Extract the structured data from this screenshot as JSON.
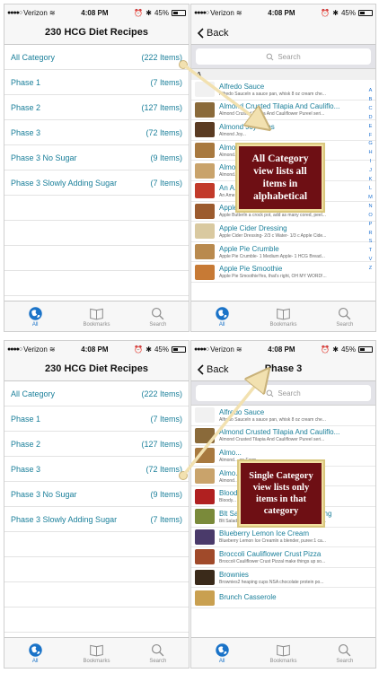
{
  "status": {
    "carrier": "Verizon",
    "time": "4:08 PM",
    "battery_text": "45%",
    "battery_level": 0.45
  },
  "home": {
    "title": "230 HCG Diet Recipes",
    "rows": [
      {
        "label": "All Category",
        "count": "(222 Items)"
      },
      {
        "label": "Phase 1",
        "count": "(7 Items)"
      },
      {
        "label": "Phase 2",
        "count": "(127 Items)"
      },
      {
        "label": "Phase 3",
        "count": "(72 Items)"
      },
      {
        "label": "Phase 3 No Sugar",
        "count": "(9 Items)"
      },
      {
        "label": "Phase 3 Slowly Adding Sugar",
        "count": "(7 Items)"
      }
    ]
  },
  "all_list": {
    "back_label": "Back",
    "search_placeholder": "Search",
    "section": "A",
    "index": [
      "A",
      "B",
      "C",
      "D",
      "E",
      "F",
      "G",
      "H",
      "I",
      "J",
      "K",
      "L",
      "M",
      "N",
      "O",
      "P",
      "R",
      "S",
      "T",
      "V",
      "Z"
    ],
    "rows": [
      {
        "title": "Alfredo Sauce",
        "desc": "Alfredo Sauceln a sauce pan, whisk 8 oz cream che...",
        "color": "#f1f1f1"
      },
      {
        "title": "Almond Crusted Tilapia And Cauliflo...",
        "desc": "Almond Crusted Tilapia And Cauliflower Pureel seri...",
        "color": "#8a6a3a"
      },
      {
        "title": "Almond Joy Bites",
        "desc": "Almond Joy...",
        "color": "#5a3b22"
      },
      {
        "title": "Almo...",
        "desc": "Almond...                on Farm...",
        "color": "#a8793f"
      },
      {
        "title": "Almo...",
        "desc": "Almond...                flour 1 t...",
        "color": "#c9a36b"
      },
      {
        "title": "An A...",
        "desc": "An Ame...              m Farm...",
        "color": "#c23a2a"
      },
      {
        "title": "Apple Butter",
        "desc": "Apple Butterln a crock pot, add as many cored, peel...",
        "color": "#9c5b2e"
      },
      {
        "title": "Apple Cider Dressing",
        "desc": "Apple Cider Dressing- 2/3 c Water- 1/3 c Apple Cide...",
        "color": "#d9c9a0"
      },
      {
        "title": "Apple Pie Crumble",
        "desc": "Apple Pie Crumble- 1 Medium Apple- 1 HCG Bread...",
        "color": "#b98a4e"
      },
      {
        "title": "Apple Pie Smoothie",
        "desc": "Apple Pie SmoothieYes, that's right, OH MY WORD!...",
        "color": "#c77a35"
      }
    ]
  },
  "phase3": {
    "back_label": "Back",
    "title": "Phase 3",
    "search_placeholder": "Search",
    "rows": [
      {
        "title": "Alfredo Sauce",
        "desc": "Alfredo Sauceln a sauce pan, whisk 8 oz cream che...",
        "color": "#f1f1f1"
      },
      {
        "title": "Almond Crusted Tilapia And Cauliflo...",
        "desc": "Almond Crusted Tilapia And Cauliflower Pureel seri...",
        "color": "#8a6a3a"
      },
      {
        "title": "Almo...",
        "desc": "Almond...              on Farm...",
        "color": "#a8793f"
      },
      {
        "title": "Almo...",
        "desc": "Almond...              flour 1 t...",
        "color": "#c9a36b"
      },
      {
        "title": "Blood...",
        "desc": "Bloody...              cooled...",
        "color": "#b02020"
      },
      {
        "title": "Blt Salad And Homemade Dressing",
        "desc": "Blt Salad And Homemade Dressingserves 2salad gr...",
        "color": "#7a8a3a"
      },
      {
        "title": "Blueberry Lemon Ice Cream",
        "desc": "Blueberry Lemon Ice Creamln a blender, puree:1 ca...",
        "color": "#4a3a6a"
      },
      {
        "title": "Broccoli Cauliflower Crust Pizza",
        "desc": "Broccoli Cauliflower Crust Pizzal make things up so...",
        "color": "#a04a2a"
      },
      {
        "title": "Brownies",
        "desc": "Brownies2 heaping cups NSA chocolate protein po...",
        "color": "#3a2a1a"
      },
      {
        "title": "Brunch Casserole",
        "desc": "",
        "color": "#c9a050"
      }
    ]
  },
  "tabs": [
    {
      "label": "All",
      "icon": "globe-icon"
    },
    {
      "label": "Bookmarks",
      "icon": "book-icon"
    },
    {
      "label": "Search",
      "icon": "search-icon"
    }
  ],
  "callouts": {
    "all": "All Category view lists all items in alphabetical",
    "single": "Single Category view lists only items in that category"
  },
  "colors": {
    "accent": "#1a7f9a",
    "tab_active": "#1a73c8",
    "callout_bg": "#6e0f14",
    "callout_border": "#f1dfa0",
    "arrow": "#f2e1b0"
  }
}
